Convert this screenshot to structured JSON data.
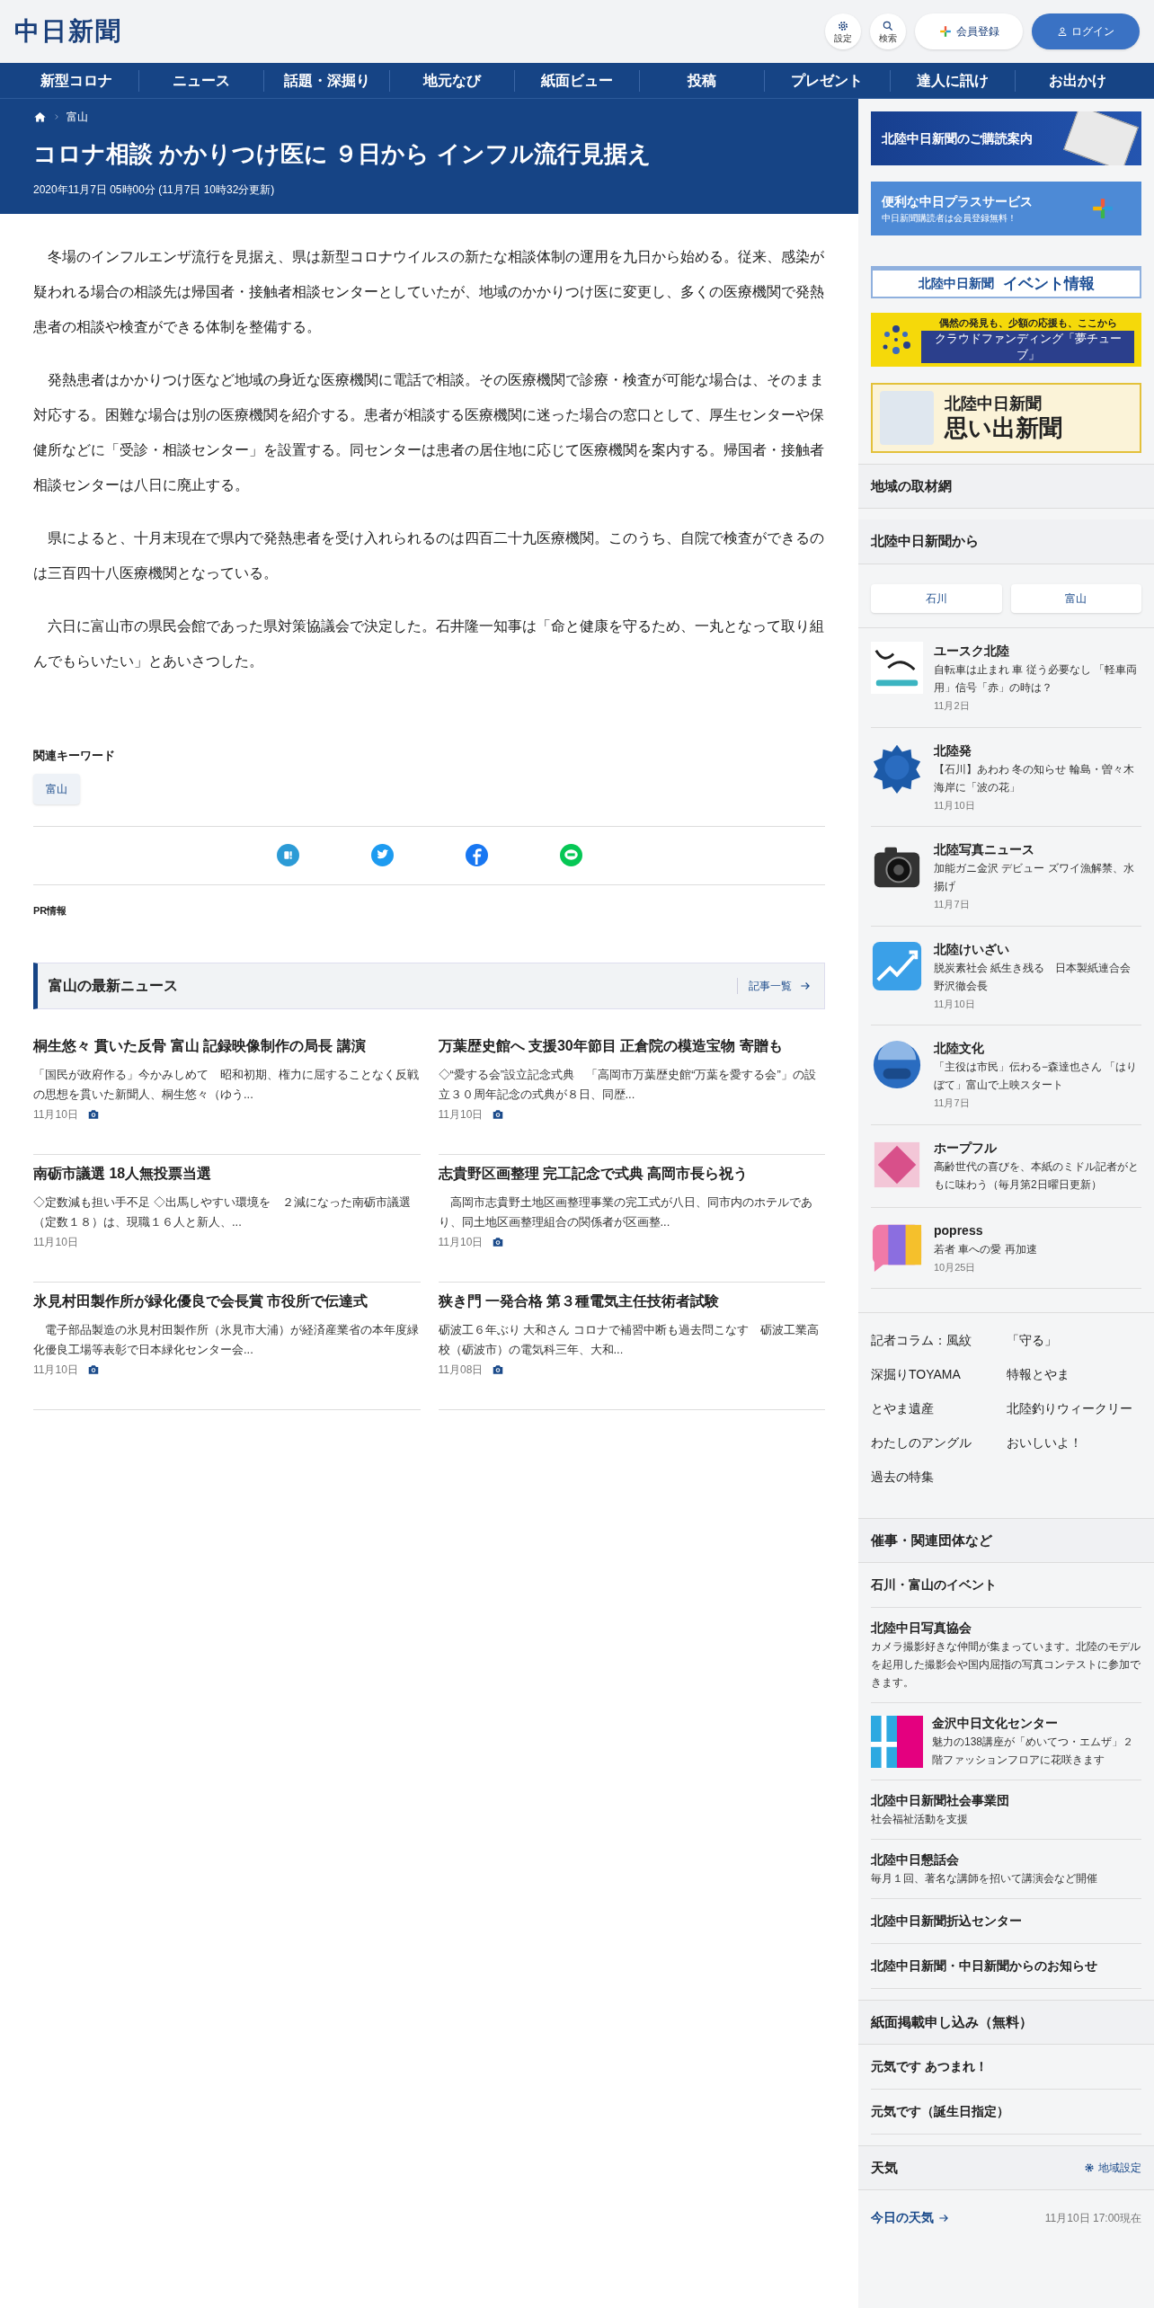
{
  "header": {
    "logo": "中日新聞",
    "icon_buttons": [
      {
        "kind": "settings",
        "label": "設定"
      },
      {
        "kind": "search",
        "label": "検索"
      }
    ],
    "register_button": "会員登録",
    "login_button": "ログイン"
  },
  "nav": [
    "新型コロナ",
    "ニュース",
    "話題・深掘り",
    "地元なび",
    "紙面ビュー",
    "投稿",
    "プレゼント",
    "達人に訊け",
    "お出かけ"
  ],
  "article": {
    "breadcrumb": [
      "富山"
    ],
    "title": "コロナ相談 かかりつけ医に ９日から インフル流行見据え",
    "timestamp": "2020年11月7日 05時00分 (11月7日 10時32分更新)",
    "paragraphs": [
      "冬場のインフルエンザ流行を見据え、県は新型コロナウイルスの新たな相談体制の運用を九日から始める。従来、感染が疑われる場合の相談先は帰国者・接触者相談センターとしていたが、地域のかかりつけ医に変更し、多くの医療機関で発熱患者の相談や検査ができる体制を整備する。",
      "発熱患者はかかりつけ医など地域の身近な医療機関に電話で相談。その医療機関で診療・検査が可能な場合は、そのまま対応する。困難な場合は別の医療機関を紹介する。患者が相談する医療機関に迷った場合の窓口として、厚生センターや保健所などに「受診・相談センター」を設置する。同センターは患者の居住地に応じて医療機関を案内する。帰国者・接触者相談センターは八日に廃止する。",
      "県によると、十月末現在で県内で発熱患者を受け入れられるのは四百二十九医療機関。このうち、自院で検査ができるのは三百四十八医療機関となっている。",
      "六日に富山市の県民会館であった県対策協議会で決定した。石井隆一知事は「命と健康を守るため、一丸となって取り組んでもらいたい」とあいさつした。"
    ],
    "keywords_heading": "関連キーワード",
    "keywords": [
      "富山"
    ],
    "share_buttons": [
      {
        "kind": "hatena"
      },
      {
        "kind": "twitter"
      },
      {
        "kind": "facebook"
      },
      {
        "kind": "line"
      }
    ],
    "pr_label": "PR情報"
  },
  "latest_news": {
    "heading": "富山の最新ニュース",
    "more_link": "記事一覧",
    "items": [
      {
        "title": "桐生悠々 貫いた反骨 富山 記録映像制作の局長 講演",
        "summary": "「国民が政府作る」今かみしめて　昭和初期、権力に屈することなく反戦の思想を貫いた新聞人、桐生悠々（ゆう...",
        "date": "11月10日",
        "photo": true
      },
      {
        "title": "万葉歴史館へ 支援30年節目 正倉院の模造宝物 寄贈も",
        "summary": "◇“愛する会”設立記念式典　「高岡市万葉歴史館“万葉を愛する会”」の設立３０周年記念の式典が８日、同歴...",
        "date": "11月10日",
        "photo": true
      },
      {
        "title": "南砺市議選 18人無投票当選",
        "summary": "◇定数減も担い手不足 ◇出馬しやすい環境を　２減になった南砺市議選（定数１８）は、現職１６人と新人、...",
        "date": "11月10日",
        "photo": false
      },
      {
        "title": "志貴野区画整理 完工記念で式典 高岡市長ら祝う",
        "summary": "　高岡市志貴野土地区画整理事業の完工式が八日、同市内のホテルであり、同土地区画整理組合の関係者が区画整...",
        "date": "11月10日",
        "photo": true
      },
      {
        "title": "氷見村田製作所が緑化優良で会長賞 市役所で伝達式",
        "summary": "　電子部品製造の氷見村田製作所（氷見市大浦）が経済産業省の本年度緑化優良工場等表彰で日本緑化センター会...",
        "date": "11月10日",
        "photo": true
      },
      {
        "title": "狭き門 一発合格 第３種電気主任技術者試験",
        "summary": "砺波工６年ぶり 大和さん コロナで補習中断も過去問こなす　砺波工業高校（砺波市）の電気科三年、大和...",
        "date": "11月08日",
        "photo": true
      }
    ]
  },
  "sidebar": {
    "banners": [
      {
        "kind": "subscribe",
        "text": "北陸中日新聞のご購読案内"
      },
      {
        "kind": "plus",
        "text": "便利な中日プラスサービス",
        "subtext": "中日新聞購読者は会員登録無料！"
      },
      {
        "kind": "event",
        "text": "北陸中日新聞",
        "subtext": "イベント情報"
      },
      {
        "kind": "crowdfunding",
        "text": "偶然の発見も、少額の応援も、ここから",
        "subtext": "クラウドファンディング「夢チューブ」"
      },
      {
        "kind": "memories",
        "text": "北陸中日新聞",
        "subtext": "思い出新聞"
      }
    ],
    "regional_network": "地域の取材網",
    "hokuriku": {
      "heading": "北陸中日新聞から",
      "tabs": [
        "石川",
        "富山"
      ],
      "items": [
        {
          "kind": "scoop",
          "name": "ユースク北陸",
          "headline": "自転車は止まれ 車 従う必要なし 「軽車両用」信号「赤」の時は？",
          "date": "11月2日"
        },
        {
          "kind": "hatsu",
          "name": "北陸発",
          "headline": "【石川】あわわ 冬の知らせ 輪島・曽々木海岸に「波の花」",
          "date": "11月10日"
        },
        {
          "kind": "camera",
          "name": "北陸写真ニュース",
          "headline": "加能ガニ金沢 デビュー ズワイ漁解禁、水揚げ",
          "date": "11月7日"
        },
        {
          "kind": "economy",
          "name": "北陸けいざい",
          "headline": "脱炭素社会 紙生き残る　日本製紙連合会野沢徹会長",
          "date": "11月10日"
        },
        {
          "kind": "culture",
          "name": "北陸文化",
          "headline": "「主役は市民」伝わる−森達也さん 「はりぼて」富山で上映スタート",
          "date": "11月7日"
        },
        {
          "kind": "hope",
          "name": "ホープフル",
          "headline": "高齢世代の喜びを、本紙のミドル記者がともに味わう（毎月第2日曜日更新）"
        },
        {
          "kind": "popress",
          "name": "popress",
          "headline": "若者 車への愛 再加速",
          "date": "10月25日"
        }
      ]
    },
    "links": [
      "記者コラム：風紋",
      "「守る」",
      "深掘りTOYAMA",
      "特報とやま",
      "とやま遺産",
      "北陸釣りウィークリー",
      "わたしのアングル",
      "おいしいよ！",
      "過去の特集"
    ],
    "events": {
      "heading": "催事・関連団体など",
      "items": [
        {
          "title": "石川・富山のイベント",
          "logo": false
        },
        {
          "title": "北陸中日写真協会",
          "description": "カメラ撮影好きな仲間が集まっています。北陸のモデルを起用した撮影会や国内屈指の写真コンテストに参加できます。",
          "logo": false
        },
        {
          "title": "金沢中日文化センター",
          "description": "魅力の138講座が「めいてつ・エムザ」２階ファッションフロアに花咲きます",
          "logo": true
        },
        {
          "title": "北陸中日新聞社会事業団",
          "description": "社会福祉活動を支援",
          "logo": false
        },
        {
          "title": "北陸中日懇話会",
          "description": "毎月１回、著名な講師を招いて講演会など開催",
          "logo": false
        },
        {
          "title": "北陸中日新聞折込センター",
          "logo": false
        },
        {
          "title": "北陸中日新聞・中日新聞からのお知らせ",
          "logo": false
        }
      ]
    },
    "submissions": {
      "heading": "紙面掲載申し込み（無料）",
      "items": [
        "元気です あつまれ！",
        "元気です（誕生日指定）"
      ]
    },
    "weather": {
      "heading": "天気",
      "settings_link": "地域設定",
      "today_link": "今日の天気",
      "as_of": "11月10日 17:00現在"
    }
  }
}
